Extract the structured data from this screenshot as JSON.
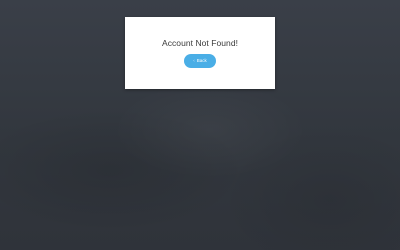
{
  "dialog": {
    "title": "Account Not Found!",
    "back_label": "Back",
    "back_icon": "chevron-left-icon"
  },
  "colors": {
    "backdrop": "#353a42",
    "dialog_background": "#ffffff",
    "button_background": "#4aaee6",
    "title_text": "#3a3a3a"
  }
}
